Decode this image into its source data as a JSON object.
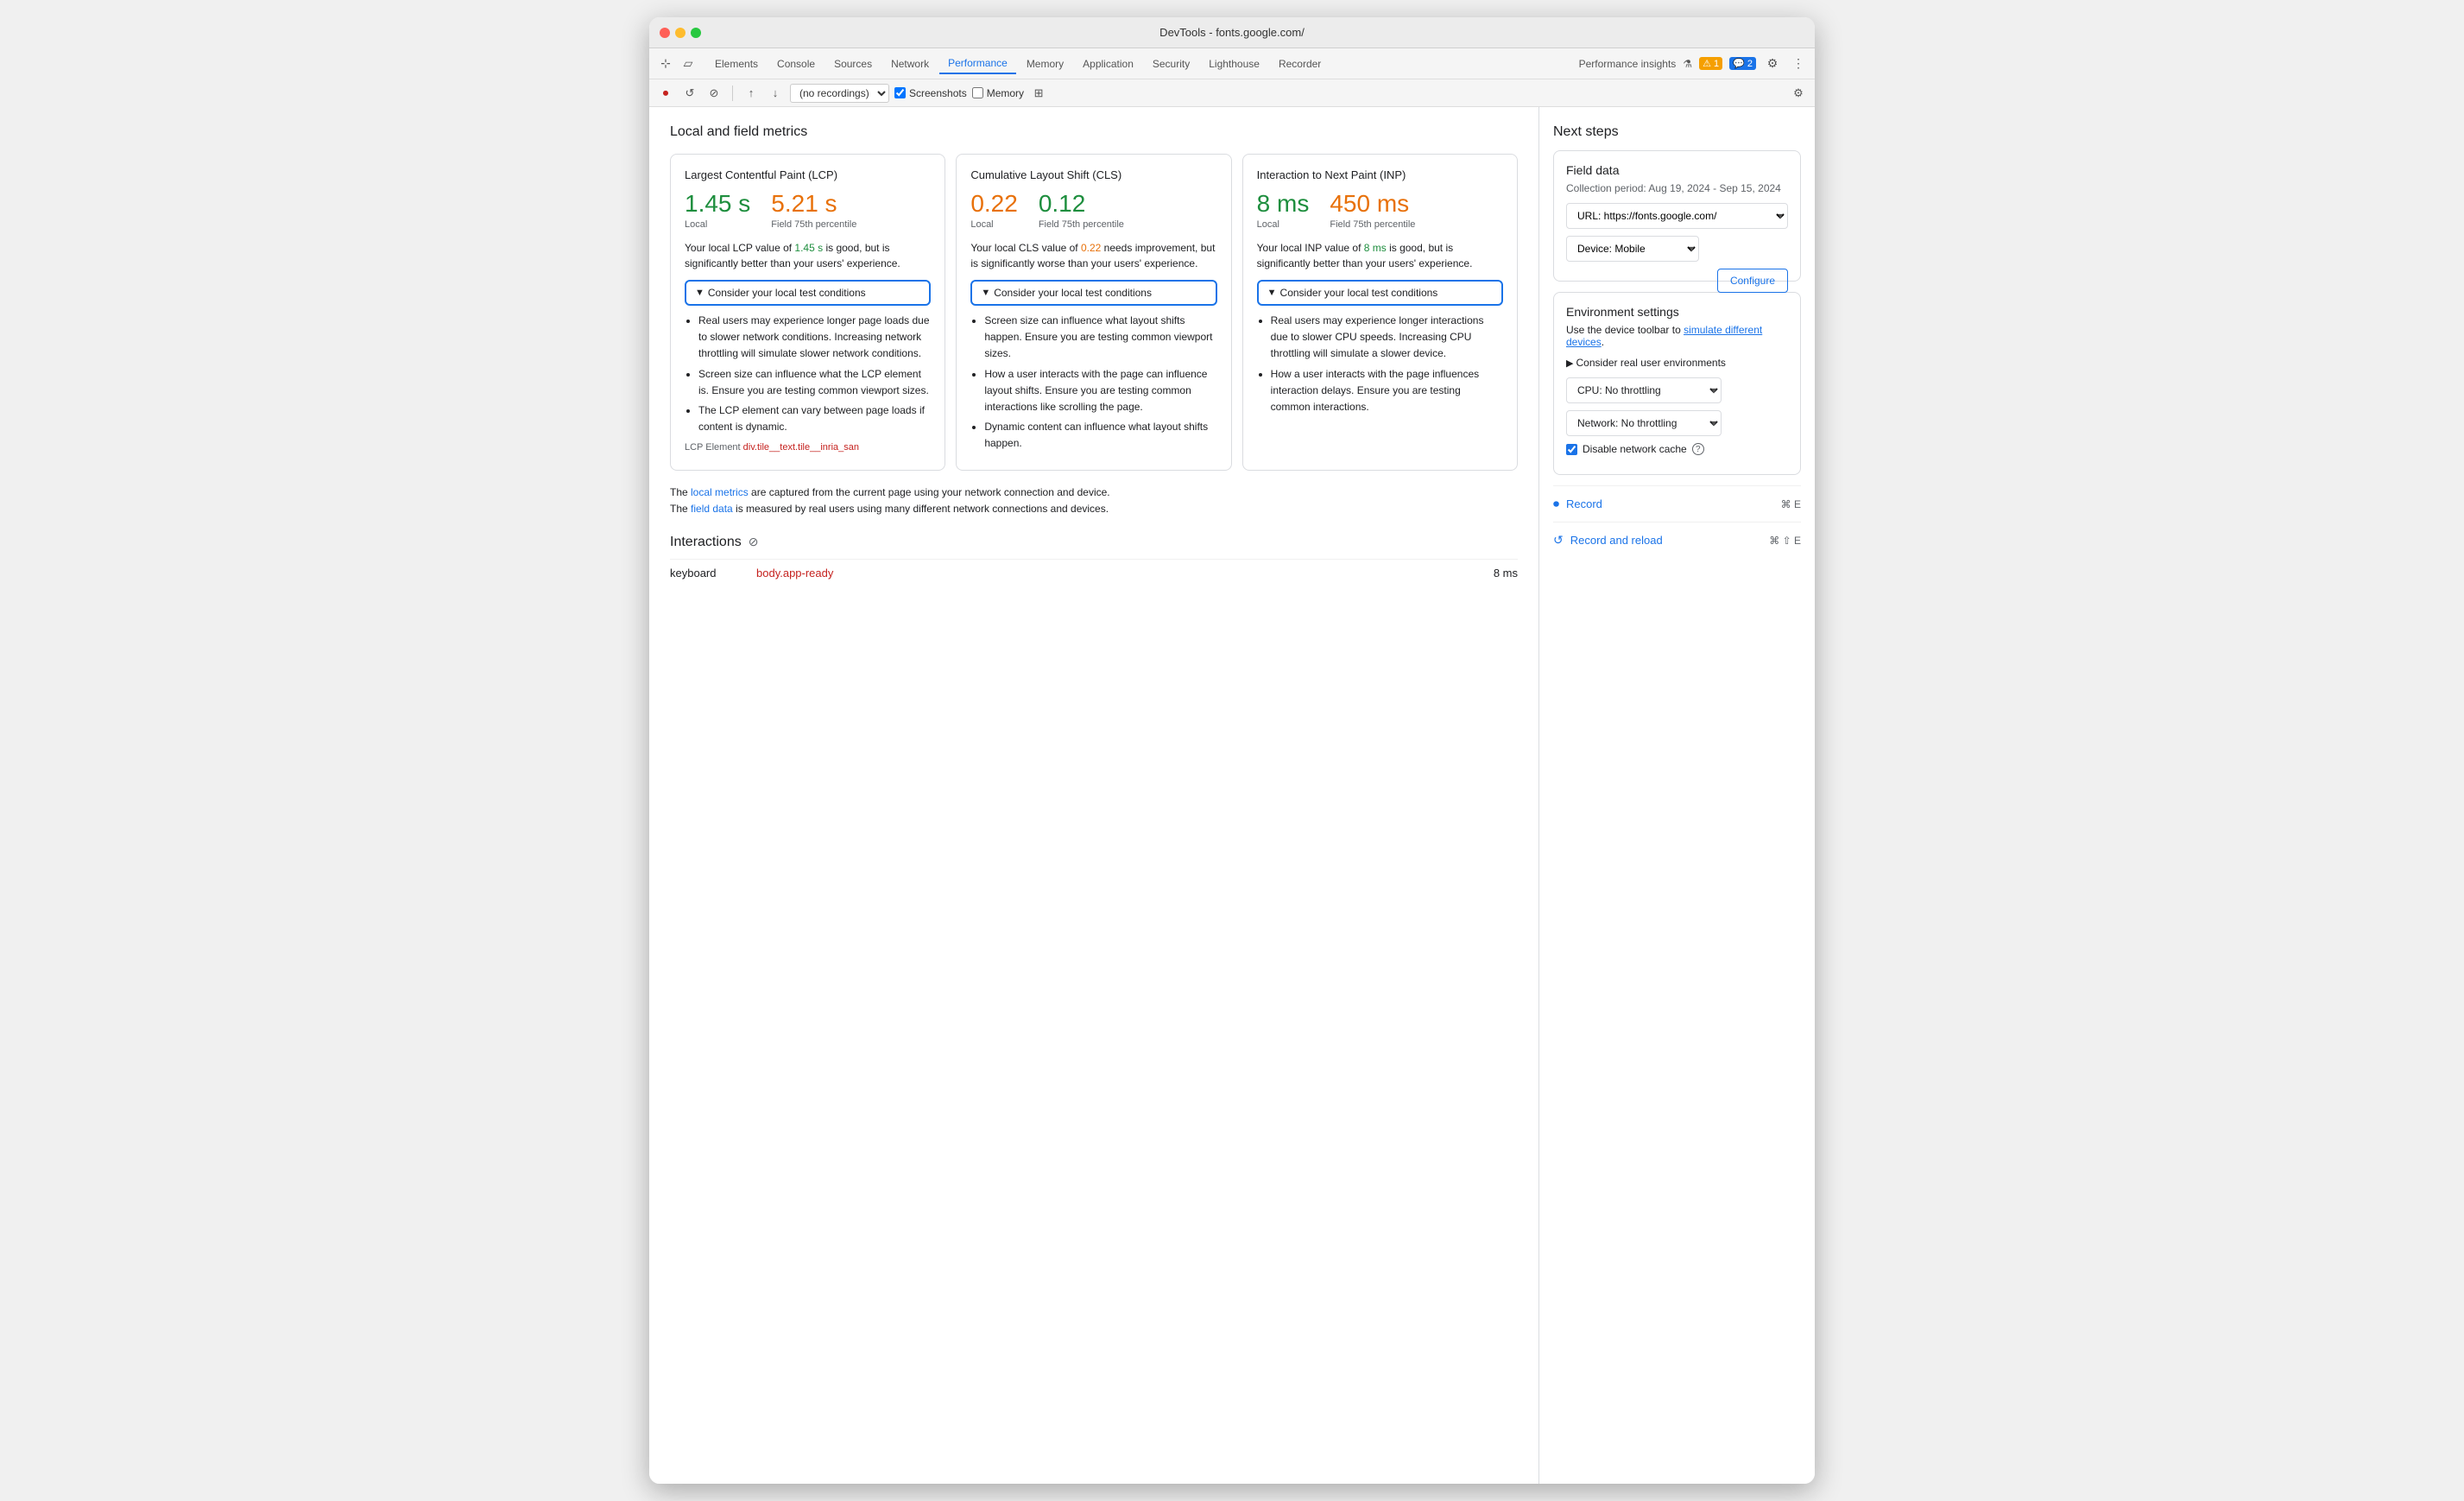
{
  "window": {
    "title": "DevTools - fonts.google.com/"
  },
  "tabs": {
    "items": [
      "Elements",
      "Console",
      "Sources",
      "Network",
      "Performance",
      "Memory",
      "Application",
      "Security",
      "Lighthouse",
      "Recorder"
    ],
    "active": "Performance",
    "right": {
      "performance_insights": "Performance insights",
      "warning_count": "1",
      "info_count": "2"
    }
  },
  "toolbar": {
    "recording_select": "(no recordings)",
    "screenshots_label": "Screenshots",
    "memory_label": "Memory"
  },
  "section_title": "Local and field metrics",
  "metrics": [
    {
      "title": "Largest Contentful Paint (LCP)",
      "local_value": "1.45 s",
      "local_value_color": "green",
      "field_value": "5.21 s",
      "field_value_color": "orange",
      "field_label": "Field 75th percentile",
      "local_label": "Local",
      "description_parts": [
        "Your local LCP value of ",
        "1.45 s",
        " is good, but is significantly better than your users' experience."
      ],
      "description_highlight": "1.45 s",
      "description_highlight_color": "green",
      "consider_label": "▼Consider your local test conditions",
      "bullets": [
        "Real users may experience longer page loads due to slower network conditions. Increasing network throttling will simulate slower network conditions.",
        "Screen size can influence what the LCP element is. Ensure you are testing common viewport sizes.",
        "The LCP element can vary between page loads if content is dynamic."
      ],
      "lcp_element_label": "LCP Element",
      "lcp_element_value": "div.tile__text.tile__inria_san"
    },
    {
      "title": "Cumulative Layout Shift (CLS)",
      "local_value": "0.22",
      "local_value_color": "orange",
      "field_value": "0.12",
      "field_value_color": "green",
      "field_label": "Field 75th percentile",
      "local_label": "Local",
      "description_parts": [
        "Your local CLS value of ",
        "0.22",
        " needs improvement, but is significantly worse than your users' experience."
      ],
      "description_highlight": "0.22",
      "description_highlight_color": "orange",
      "consider_label": "▼Consider your local test conditions",
      "bullets": [
        "Screen size can influence what layout shifts happen. Ensure you are testing common viewport sizes.",
        "How a user interacts with the page can influence layout shifts. Ensure you are testing common interactions like scrolling the page.",
        "Dynamic content can influence what layout shifts happen."
      ]
    },
    {
      "title": "Interaction to Next Paint (INP)",
      "local_value": "8 ms",
      "local_value_color": "green",
      "field_value": "450 ms",
      "field_value_color": "orange",
      "field_label": "Field 75th percentile",
      "local_label": "Local",
      "description_parts": [
        "Your local INP value of ",
        "8 ms",
        " is good, but is significantly better than your users' experience."
      ],
      "description_highlight": "8 ms",
      "description_highlight_color": "green",
      "consider_label": "▼Consider your local test conditions",
      "bullets": [
        "Real users may experience longer interactions due to slower CPU speeds. Increasing CPU throttling will simulate a slower device.",
        "How a user interacts with the page influences interaction delays. Ensure you are testing common interactions."
      ]
    }
  ],
  "footer_note": {
    "part1": "The ",
    "local_metrics_link": "local metrics",
    "part2": " are captured from the current page using your network connection and device.",
    "part3": "\nThe ",
    "field_data_link": "field data",
    "part4": " is measured by real users using many different network connections and devices."
  },
  "interactions": {
    "title": "Interactions",
    "rows": [
      {
        "name": "keyboard",
        "target": "body.app-ready",
        "time": "8 ms"
      }
    ]
  },
  "sidebar": {
    "title": "Next steps",
    "field_data": {
      "title": "Field data",
      "collection_period": "Collection period: Aug 19, 2024 - Sep 15, 2024",
      "url_label": "URL: https://fonts.google.com/",
      "device_label": "Device: Mobile",
      "configure_btn": "Configure"
    },
    "env_settings": {
      "title": "Environment settings",
      "desc_part1": "Use the device toolbar to ",
      "simulate_link": "simulate different devices",
      "desc_part2": ".",
      "consider_real": "▶ Consider real user environments",
      "cpu_label": "CPU: No throttling",
      "network_label": "Network: No throttling",
      "disable_cache_label": "Disable network cache"
    },
    "record": {
      "label": "Record",
      "shortcut": "⌘ E",
      "icon": "⏺"
    },
    "record_reload": {
      "label": "Record and reload",
      "shortcut": "⌘ ⇧ E",
      "icon": "↺"
    }
  }
}
